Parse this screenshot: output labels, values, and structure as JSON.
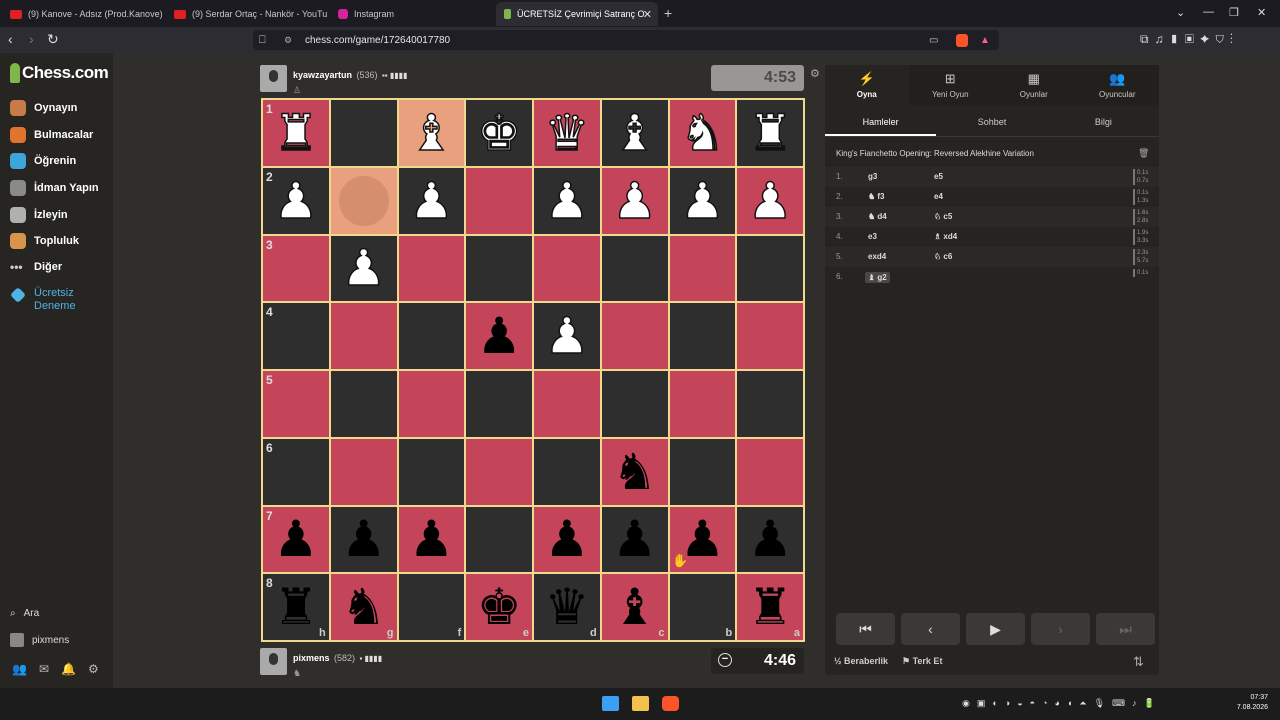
{
  "browser": {
    "tabs": [
      {
        "title": "(9) Kanove - Adsız (Prod.Kanove) - Yo",
        "active": false
      },
      {
        "title": "(9) Serdar Ortaç - Nankör - YouTu",
        "active": false
      },
      {
        "title": "Instagram",
        "active": false
      },
      {
        "title": "ÜCRETSİZ Çevrimiçi Satranç O",
        "active": true
      }
    ],
    "url": "chess.com/game/172640017780"
  },
  "sidebar": {
    "logo": "Chess.com",
    "items": [
      {
        "label": "Oynayın",
        "icon": "play-icon"
      },
      {
        "label": "Bulmacalar",
        "icon": "puzzle-icon"
      },
      {
        "label": "Öğrenin",
        "icon": "learn-icon"
      },
      {
        "label": "İdman Yapın",
        "icon": "train-icon"
      },
      {
        "label": "İzleyin",
        "icon": "watch-icon"
      },
      {
        "label": "Topluluk",
        "icon": "community-icon"
      },
      {
        "label": "Diğer",
        "icon": "more-icon"
      }
    ],
    "trial": "Ücretsiz Deneme",
    "search": "Ara",
    "user": "pixmens"
  },
  "game": {
    "top_player": {
      "name": "kyawzayartun",
      "rating": "(536)",
      "clock": "4:53"
    },
    "bottom_player": {
      "name": "pixmens",
      "rating": "(582)",
      "clock": "4:46"
    },
    "ranks": [
      "1",
      "2",
      "3",
      "4",
      "5",
      "6",
      "7",
      "8"
    ],
    "files": [
      "h",
      "g",
      "f",
      "e",
      "d",
      "c",
      "b",
      "a"
    ],
    "board": [
      [
        "wR",
        "",
        "wB",
        "wK",
        "wQ",
        "wB",
        "wN",
        "wR"
      ],
      [
        "wP",
        "",
        "wP",
        "",
        "wP",
        "wP",
        "wP",
        "wP"
      ],
      [
        "",
        "wP",
        "",
        "",
        "",
        "",
        "",
        ""
      ],
      [
        "",
        "",
        "",
        "bP",
        "wP",
        "",
        "",
        ""
      ],
      [
        "",
        "",
        "",
        "",
        "",
        "",
        "",
        ""
      ],
      [
        "",
        "",
        "",
        "",
        "",
        "bN",
        "",
        ""
      ],
      [
        "bP",
        "bP",
        "bP",
        "",
        "bP",
        "bP",
        "bP",
        "bP"
      ],
      [
        "bR",
        "bN",
        "",
        "bK",
        "bQ",
        "bB",
        "",
        "bR"
      ]
    ]
  },
  "panel": {
    "tabs": [
      "Oyna",
      "Yeni Oyun",
      "Oyunlar",
      "Oyuncular"
    ],
    "subtabs": [
      "Hamleler",
      "Sohbet",
      "Bilgi"
    ],
    "opening": "King's Fianchetto Opening: Reversed Alekhine Variation",
    "moves": [
      {
        "n": "1.",
        "w": "g3",
        "b": "e5",
        "t1": "0.1s",
        "t2": "0.7s"
      },
      {
        "n": "2.",
        "w": "♞ f3",
        "b": "e4",
        "t1": "0.1s",
        "t2": "1.3s"
      },
      {
        "n": "3.",
        "w": "♞ d4",
        "b": "♘ c5",
        "t1": "1.6s",
        "t2": "2.8s"
      },
      {
        "n": "4.",
        "w": "e3",
        "b": "♗ xd4",
        "t1": "1.9s",
        "t2": "3.3s"
      },
      {
        "n": "5.",
        "w": "exd4",
        "b": "♘ c6",
        "t1": "2.3s",
        "t2": "5.7s"
      },
      {
        "n": "6.",
        "w": "♝ g2",
        "b": "",
        "t1": "0.1s",
        "t2": ""
      }
    ],
    "draw": "½ Beraberlik",
    "resign": "Terk Et"
  },
  "taskbar": {
    "time": "07:37",
    "date": "7.08.2026"
  }
}
